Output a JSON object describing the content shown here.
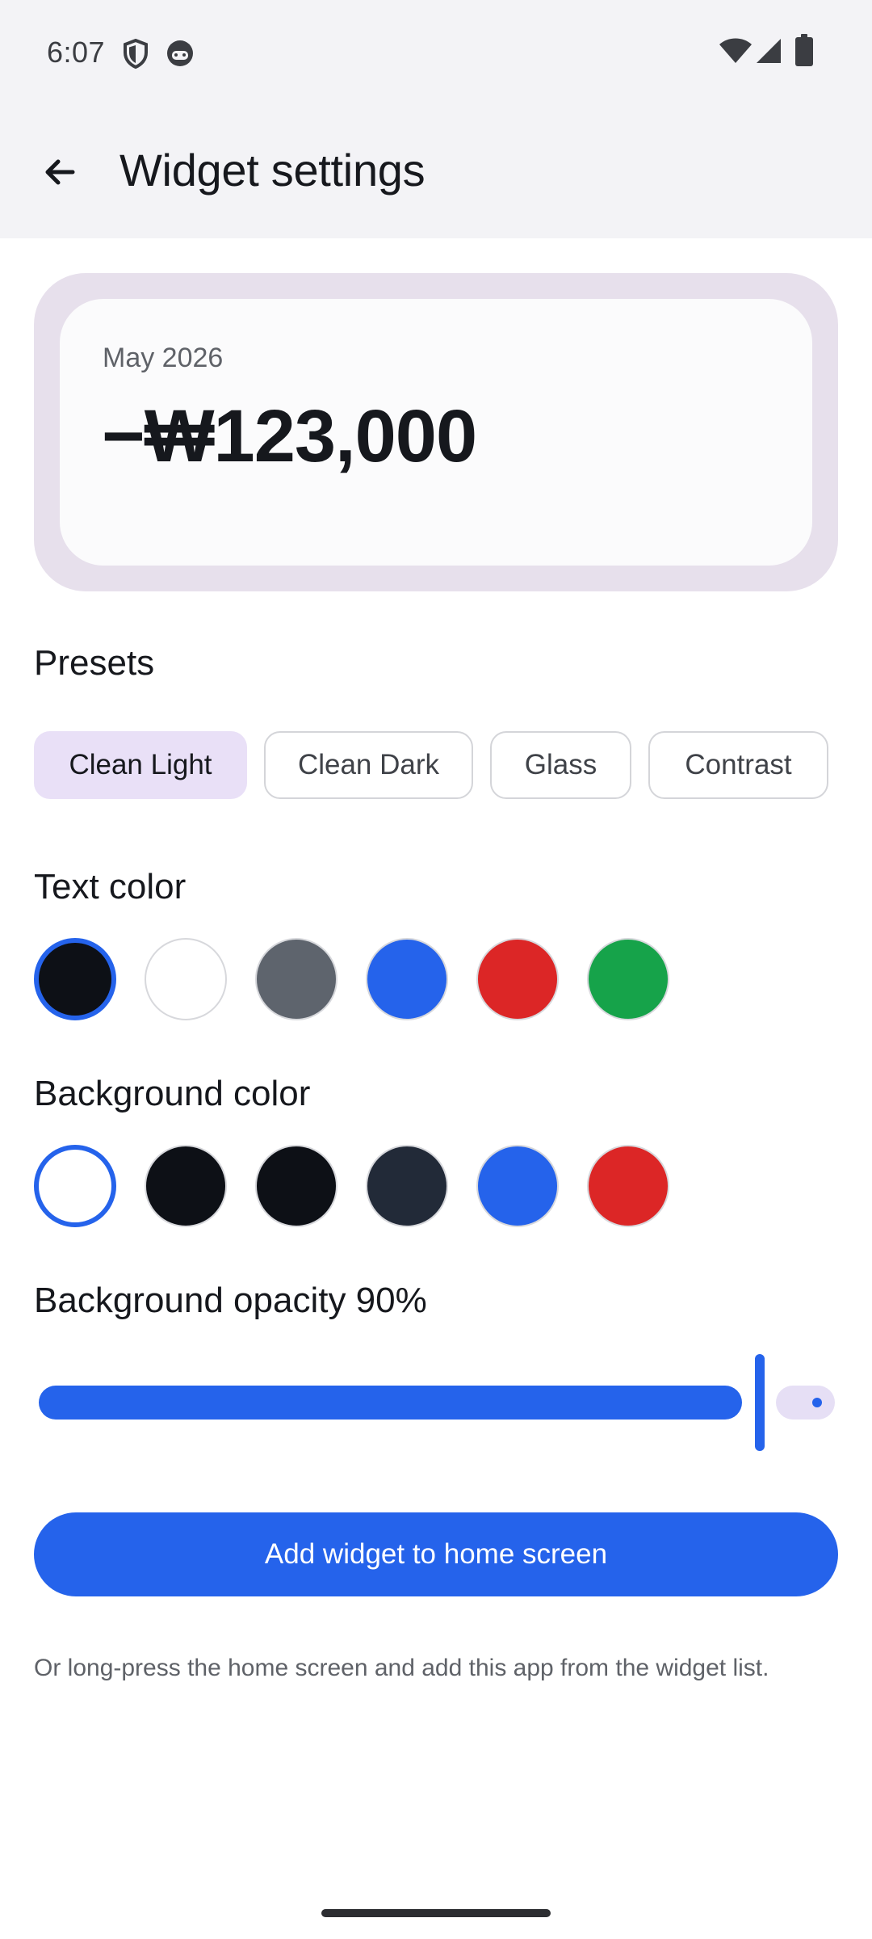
{
  "status_bar": {
    "time": "6:07",
    "icons_left": [
      "shield-icon",
      "app-notification-icon"
    ],
    "icons_right": [
      "wifi-icon",
      "signal-icon",
      "battery-icon"
    ]
  },
  "app_bar": {
    "title": "Widget settings",
    "back_icon": "arrow-back-icon"
  },
  "preview": {
    "month": "May 2026",
    "amount": "−₩123,000",
    "frame_color": "#e7e0ec",
    "card_color": "#fbfbfc"
  },
  "presets": {
    "title": "Presets",
    "selected": "Clean Light",
    "options": [
      "Clean Light",
      "Clean Dark",
      "Glass",
      "Contrast"
    ]
  },
  "text_color": {
    "title": "Text color",
    "selected_index": 0,
    "colors": [
      "#0d1016",
      "#ffffff",
      "#5e646d",
      "#2563eb",
      "#dc2626",
      "#16a34a"
    ]
  },
  "background_color": {
    "title": "Background color",
    "selected_index": 0,
    "colors": [
      "#ffffff",
      "#0d1016",
      "#0d1016",
      "#222a38",
      "#2563eb",
      "#dc2626"
    ]
  },
  "opacity": {
    "title": "Background opacity 90%",
    "value_percent": 90
  },
  "add_button": {
    "label": "Add widget to home screen"
  },
  "hint": "Or long-press the home screen and add this app from the widget list.",
  "accent_color": "#2563eb"
}
